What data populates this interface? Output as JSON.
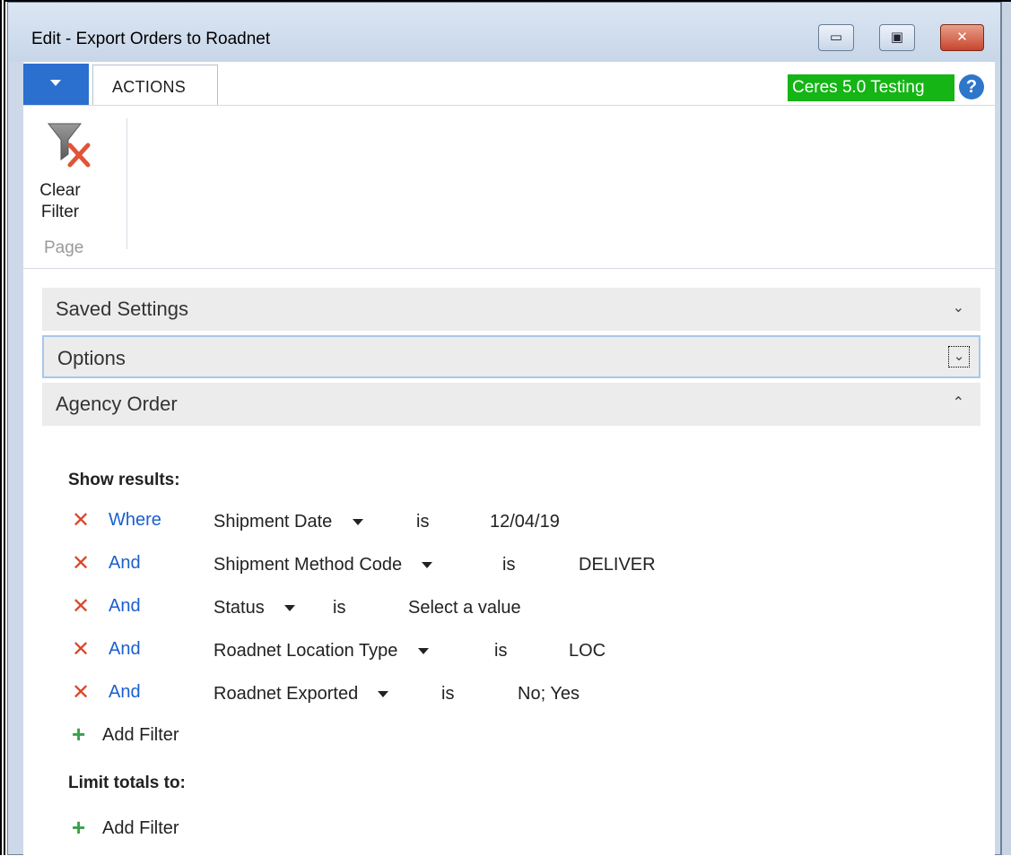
{
  "window": {
    "title": "Edit - Export Orders to Roadnet",
    "controls": {
      "minimize_icon": "minimize-icon",
      "maximize_icon": "maximize-icon",
      "close_icon": "close-icon"
    }
  },
  "ribbon": {
    "tabs": [
      {
        "label": "ACTIONS"
      }
    ],
    "company_badge": "Ceres 5.0 Testing",
    "company_badge_color": "#14b514",
    "help_icon": "?",
    "actions": [
      {
        "label_line1": "Clear",
        "label_line2": "Filter",
        "icon": "clear-filter-icon"
      }
    ],
    "group_label": "Page"
  },
  "fasttabs": [
    {
      "title": "Saved Settings",
      "state": "collapsed"
    },
    {
      "title": "Options",
      "state": "collapsed"
    },
    {
      "title": "Agency Order",
      "state": "expanded"
    }
  ],
  "filters": {
    "show_results_label": "Show results:",
    "rows": [
      {
        "conjunction": "Where",
        "field": "Shipment Date",
        "operator": "is",
        "value": "12/04/19"
      },
      {
        "conjunction": "And",
        "field": "Shipment Method Code",
        "operator": "is",
        "value": "DELIVER"
      },
      {
        "conjunction": "And",
        "field": "Status",
        "operator": "is",
        "value": "Select a value"
      },
      {
        "conjunction": "And",
        "field": "Roadnet Location Type",
        "operator": "is",
        "value": "LOC"
      },
      {
        "conjunction": "And",
        "field": "Roadnet Exported",
        "operator": "is",
        "value": "No; Yes"
      }
    ],
    "add_filter_label": "Add Filter",
    "limit_totals_label": "Limit totals to:",
    "limit_add_filter_label": "Add Filter"
  },
  "colors": {
    "link": "#1a5fcf",
    "remove_icon": "#d9482a",
    "add_icon": "#3aa04a",
    "app_button": "#2b6fcf"
  }
}
